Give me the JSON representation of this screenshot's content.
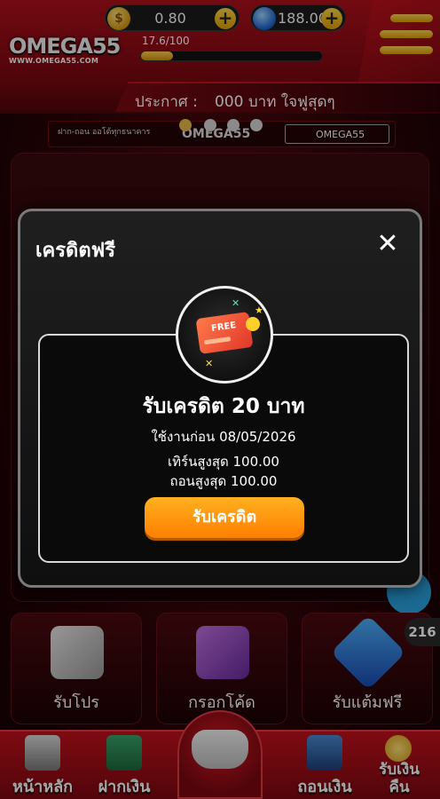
{
  "header": {
    "logo_text": "OMEGA55",
    "logo_url": "WWW.OMEGA55.COM",
    "credit_value": "0.80",
    "diamond_value": "188.00",
    "level_text": "17.6/100",
    "level_progress": 0.176,
    "announce_label": "ประกาศ :",
    "announce_text": "000 บาท ใจฟูสุดๆ"
  },
  "banner": {
    "promo_text": "ฝาก-ถอน ออโต้ทุกธนาคาร",
    "brand_text": "OMEGA55",
    "search_text": "OMEGA55"
  },
  "tiles": [
    {
      "label": "รับโปร"
    },
    {
      "label": "กรอกโค้ด"
    },
    {
      "label": "รับแต้มฟรี"
    }
  ],
  "badge_count": "216",
  "bottom_nav": {
    "home": "หน้าหลัก",
    "deposit": "ฝากเงิน",
    "withdraw": "ถอนเงิน",
    "cashback_line1": "รับเงิน",
    "cashback_line2": "คืน"
  },
  "modal": {
    "title": "เครดิตฟรี",
    "close_glyph": "✕",
    "free_badge_text": "FREE",
    "reward_title": "รับเครดิต 20 บาท",
    "expiry": "ใช้งานก่อน 08/05/2026",
    "max_turnover": "เทิร์นสูงสุด 100.00",
    "max_withdraw": "ถอนสูงสุด 100.00",
    "claim_button": "รับเครดิต"
  },
  "colors": {
    "brand_red": "#c3111d",
    "accent_gold": "#ffb020",
    "modal_bg": "#1a1a1a"
  }
}
